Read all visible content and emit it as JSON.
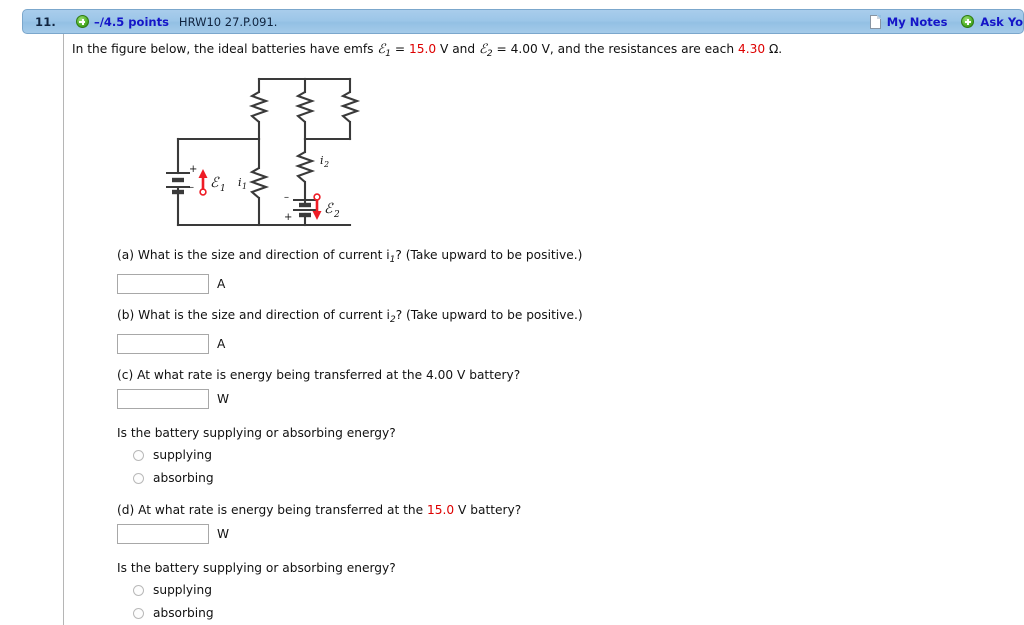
{
  "header": {
    "question_number": "11.",
    "points": "–/4.5 points",
    "question_code": "HRW10 27.P.091.",
    "my_notes_label": "My Notes",
    "ask_teacher_label": "Ask Yo",
    "plus_icon": "plus-circle-icon",
    "note_icon": "note-page-icon",
    "bar_color": "#9cc6e8",
    "link_color": "#1414c8"
  },
  "intro": {
    "part1": "In the figure below, the ideal batteries have emfs ",
    "emf1_symbol": "ℰ",
    "emf1_sub": "1",
    "eq1": " = ",
    "emf1_value": "15.0",
    "mid1": " V and ",
    "emf2_symbol": "ℰ",
    "emf2_sub": "2",
    "eq2": " = ",
    "emf2_value": "4.00",
    "mid2": " V, and the resistances are each ",
    "resistance_value": "4.30",
    "unit_ohm": " Ω.",
    "red_color": "#dd0000"
  },
  "figure": {
    "name": "circuit-diagram",
    "labels": {
      "emf1": "ℰ",
      "emf1_sub": "1",
      "emf2": "ℰ",
      "emf2_sub": "2",
      "i1": "i",
      "i1_sub": "1",
      "i2": "i",
      "i2_sub": "2",
      "battery1_plus": "+",
      "battery1_minus": "−",
      "battery2_plus": "+",
      "battery2_minus": "−"
    },
    "arrow_color": "#ee1c25",
    "wire_color": "#3a3a3a",
    "resistor_count": 5
  },
  "parts": [
    {
      "id": "a",
      "question": "(a) What is the size and direction of current i",
      "question_sub": "1",
      "question_tail": "? (Take upward to be positive.)",
      "value": "",
      "placeholder": "",
      "unit": "A"
    },
    {
      "id": "b",
      "question": "(b) What is the size and direction of current i",
      "question_sub": "2",
      "question_tail": "? (Take upward to be positive.)",
      "value": "",
      "placeholder": "",
      "unit": "A"
    },
    {
      "id": "c",
      "question_pre": "(c) At what rate is energy being transferred at the ",
      "question_value": "4.00",
      "question_value_red": false,
      "question_post": " V battery?",
      "value": "",
      "placeholder": "",
      "unit": "W",
      "followup": "Is the battery supplying or absorbing energy?",
      "options": [
        "supplying",
        "absorbing"
      ]
    },
    {
      "id": "d",
      "question_pre": "(d) At what rate is energy being transferred at the ",
      "question_value": "15.0",
      "question_value_red": true,
      "question_post": " V battery?",
      "value": "",
      "placeholder": "",
      "unit": "W",
      "followup": "Is the battery supplying or absorbing energy?",
      "options": [
        "supplying",
        "absorbing"
      ]
    }
  ]
}
